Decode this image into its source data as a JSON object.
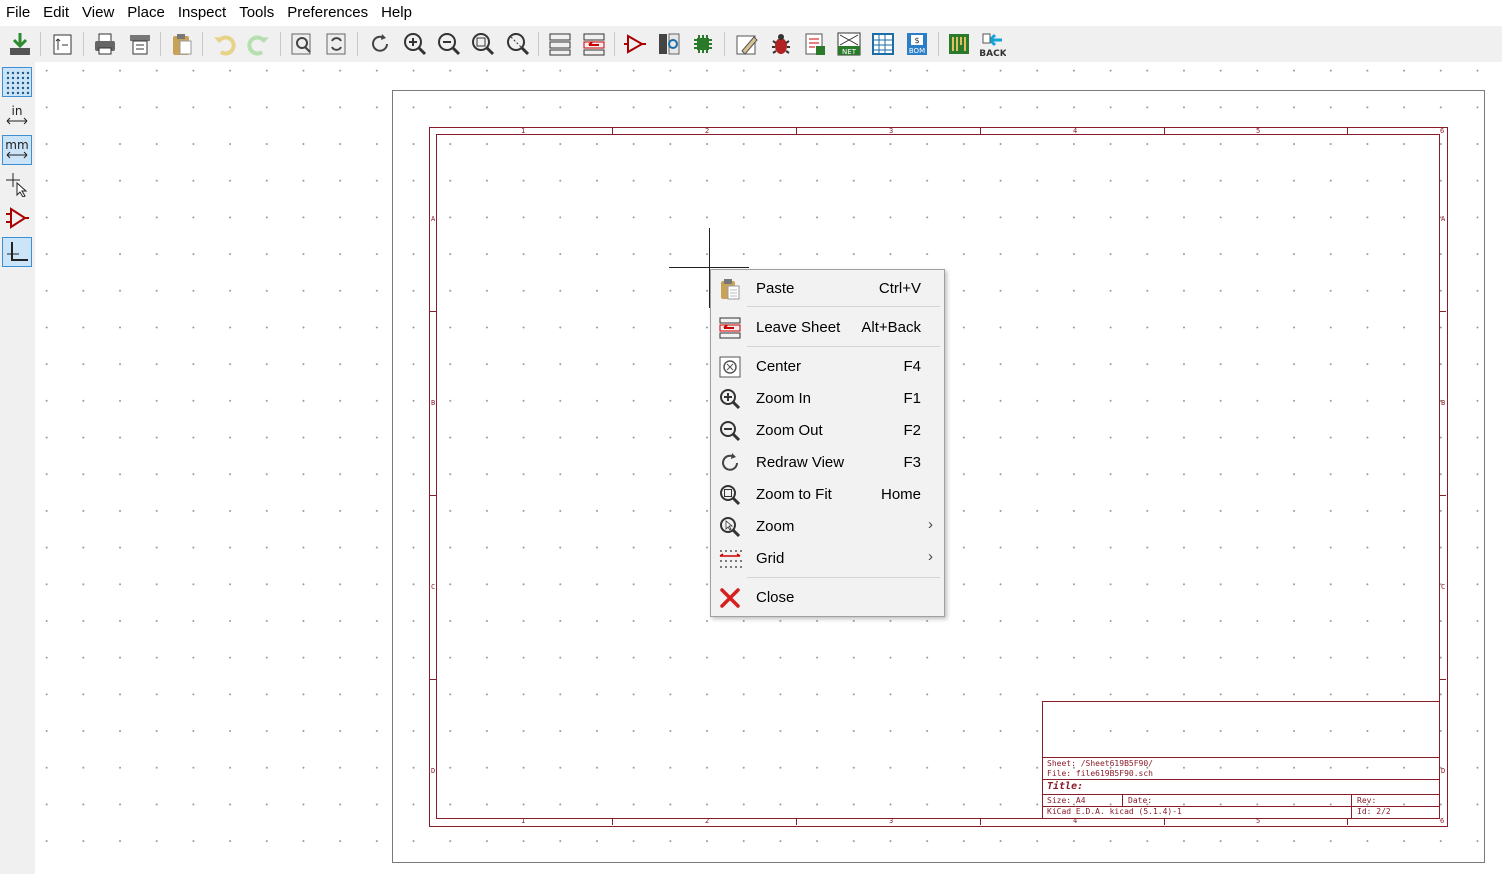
{
  "menubar": [
    "File",
    "Edit",
    "View",
    "Place",
    "Inspect",
    "Tools",
    "Preferences",
    "Help"
  ],
  "toolbar": {
    "back_label": "BACK",
    "net_label": "NET",
    "bom_label": "BOM",
    "bom_dollar": "$"
  },
  "left_toolbar": {
    "in_label": "in",
    "mm_label": "mm"
  },
  "sheet": {
    "col_labels": [
      "1",
      "2",
      "3",
      "4",
      "5",
      "6"
    ],
    "row_labels": [
      "A",
      "B",
      "C",
      "D"
    ],
    "sheet_line": "Sheet: /Sheet619B5F90/",
    "file_line": "File: file619B5F90.sch",
    "title_label": "Title:",
    "size_label": "Size: A4",
    "date_label": "Date:",
    "rev_label": "Rev:",
    "kicad_line": "KiCad E.D.A.  kicad (5.1.4)-1",
    "id_label": "Id: 2/2"
  },
  "context_menu": {
    "items": [
      {
        "label": "Paste",
        "shortcut": "Ctrl+V",
        "icon": "paste-icon"
      },
      {
        "label": "Leave Sheet",
        "shortcut": "Alt+Back",
        "icon": "leave-sheet-icon"
      },
      {
        "label": "Center",
        "shortcut": "F4",
        "icon": "center-icon"
      },
      {
        "label": "Zoom In",
        "shortcut": "F1",
        "icon": "zoom-in-icon"
      },
      {
        "label": "Zoom Out",
        "shortcut": "F2",
        "icon": "zoom-out-icon"
      },
      {
        "label": "Redraw View",
        "shortcut": "F3",
        "icon": "redraw-icon"
      },
      {
        "label": "Zoom to Fit",
        "shortcut": "Home",
        "icon": "zoom-fit-icon"
      },
      {
        "label": "Zoom",
        "shortcut": "",
        "icon": "zoom-icon",
        "submenu": true
      },
      {
        "label": "Grid",
        "shortcut": "",
        "icon": "grid-icon",
        "submenu": true
      },
      {
        "label": "Close",
        "shortcut": "",
        "icon": "close-icon"
      }
    ]
  },
  "colors": {
    "frame": "#8a1c2a",
    "toolbar_bg": "#f0f0f0",
    "active_button_bg": "#cce4f7",
    "menu_bg": "#f2f2f2"
  }
}
